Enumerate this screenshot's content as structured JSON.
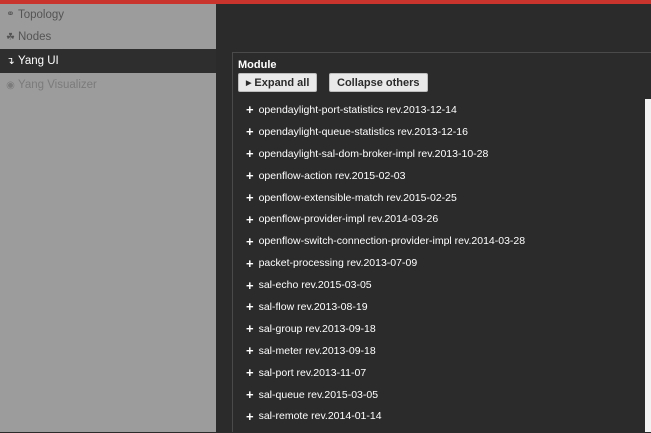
{
  "sidebar": {
    "items": [
      {
        "label": "Topology",
        "icon": "topology-icon",
        "glyph": "⚭"
      },
      {
        "label": "Nodes",
        "icon": "nodes-icon",
        "glyph": "☘"
      },
      {
        "label": "Yang UI",
        "icon": "yang-ui-icon",
        "glyph": "↴"
      },
      {
        "label": "Yang Visualizer",
        "icon": "eye-icon",
        "glyph": "◉"
      }
    ],
    "active_index": 2
  },
  "panel": {
    "title": "Module",
    "expand_label": "Expand all",
    "collapse_label": "Collapse others"
  },
  "modules": [
    "opendaylight-port-statistics rev.2013-12-14",
    "opendaylight-queue-statistics rev.2013-12-16",
    "opendaylight-sal-dom-broker-impl rev.2013-10-28",
    "openflow-action rev.2015-02-03",
    "openflow-extensible-match rev.2015-02-25",
    "openflow-provider-impl rev.2014-03-26",
    "openflow-switch-connection-provider-impl rev.2014-03-28",
    "packet-processing rev.2013-07-09",
    "sal-echo rev.2015-03-05",
    "sal-flow rev.2013-08-19",
    "sal-group rev.2013-09-18",
    "sal-meter rev.2013-09-18",
    "sal-port rev.2013-11-07",
    "sal-queue rev.2015-03-05",
    "sal-remote rev.2014-01-14"
  ],
  "colors": {
    "accent": "#c9342c",
    "sidebar_bg": "#9c9c9c",
    "active_bg": "#2e2e2e",
    "main_bg": "#2b2b2b"
  }
}
